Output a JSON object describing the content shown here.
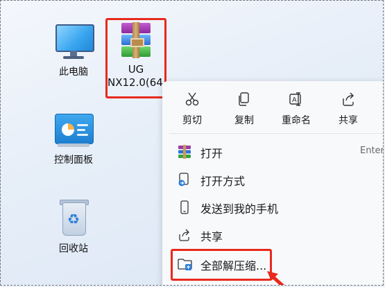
{
  "desktop": {
    "icons": [
      {
        "label": "此电脑"
      },
      {
        "label": "控制面板"
      },
      {
        "label": "回收站"
      }
    ],
    "selected_file": {
      "label_line1": "UG",
      "label_line2": "NX12.0(64."
    }
  },
  "context_menu": {
    "quick_actions": [
      {
        "label": "剪切",
        "icon": "scissors-icon"
      },
      {
        "label": "复制",
        "icon": "copy-icon"
      },
      {
        "label": "重命名",
        "icon": "rename-icon"
      },
      {
        "label": "共享",
        "icon": "share-icon"
      }
    ],
    "items": [
      {
        "label": "打开",
        "shortcut": "Enter",
        "icon": "winrar-icon"
      },
      {
        "label": "打开方式",
        "icon": "open-with-icon"
      },
      {
        "label": "发送到我的手机",
        "icon": "phone-icon"
      },
      {
        "label": "共享",
        "icon": "share-icon"
      },
      {
        "label": "全部解压缩...",
        "icon": "extract-folder-icon"
      }
    ]
  },
  "colors": {
    "highlight_border": "#e8291c",
    "menu_background": "#f8f9fb"
  }
}
